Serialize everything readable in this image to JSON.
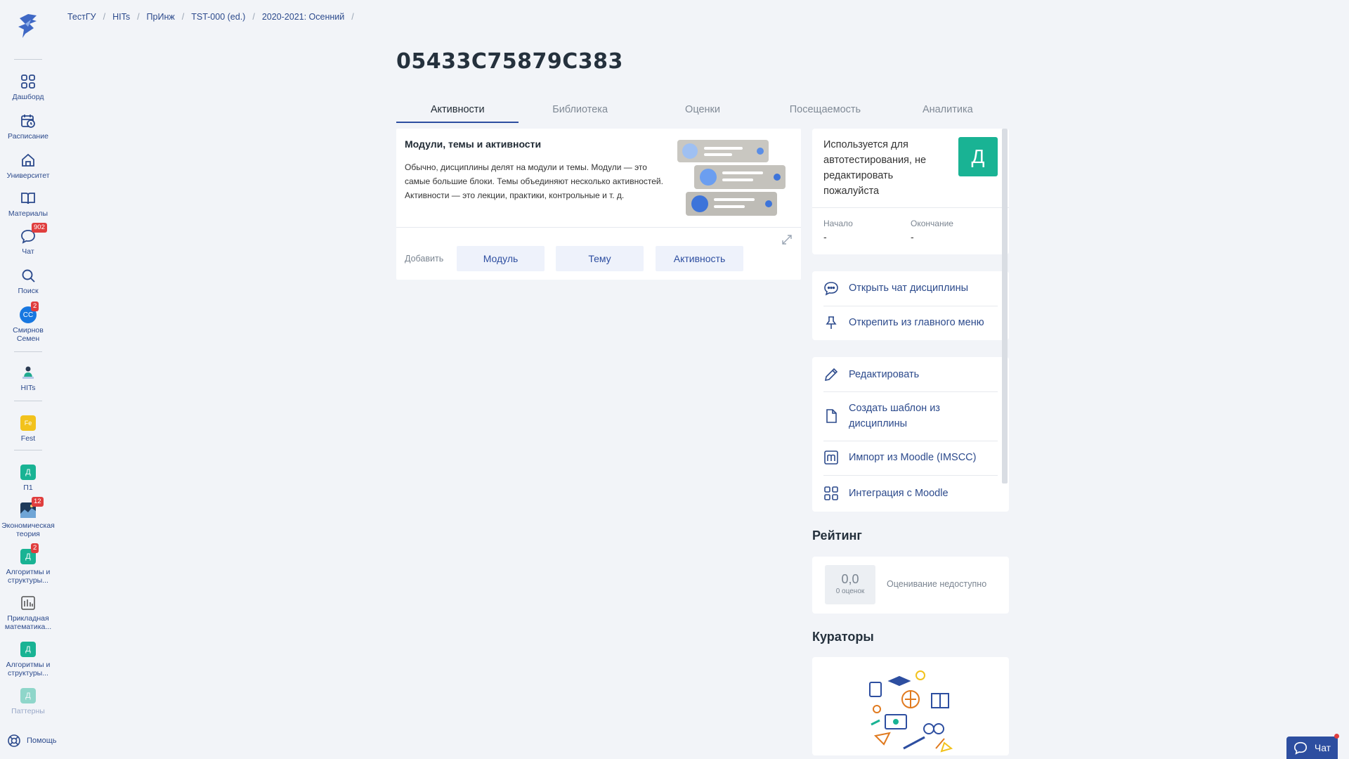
{
  "sidebar": {
    "items": [
      {
        "label": "Дашборд"
      },
      {
        "label": "Расписание"
      },
      {
        "label": "Университет"
      },
      {
        "label": "Материалы"
      },
      {
        "label": "Чат",
        "badge": "902"
      },
      {
        "label": "Поиск"
      },
      {
        "label": "Смирнов Семен",
        "avatar": "СС",
        "badge": "2"
      },
      {
        "label": "HITs"
      },
      {
        "label": "Fest",
        "avatar": "Fe"
      },
      {
        "label": "П1",
        "avatar": "Д"
      },
      {
        "label": "Экономическая теория",
        "badge": "12"
      },
      {
        "label": "Алгоритмы и структуры...",
        "avatar": "Д",
        "badge": "2"
      },
      {
        "label": "Прикладная математика..."
      },
      {
        "label": "Алгоритмы и структуры...",
        "avatar": "Д"
      },
      {
        "label": "Паттерны",
        "avatar": "Д"
      }
    ],
    "help_label": "Помощь"
  },
  "breadcrumbs": [
    "ТестГУ",
    "HITs",
    "ПрИнж",
    "TST-000 (ed.)",
    "2020-2021: Осенний"
  ],
  "page_title": "05433C75879C383",
  "tabs": [
    {
      "label": "Активности",
      "active": true
    },
    {
      "label": "Библиотека"
    },
    {
      "label": "Оценки"
    },
    {
      "label": "Посещаемость"
    },
    {
      "label": "Аналитика"
    }
  ],
  "modules_card": {
    "title": "Модули, темы и активности",
    "description": "Обычно, дисциплины делят на модули и темы. Модули — это самые большие блоки. Темы объединяют несколько активностей. Активности — это лекции, практики, контрольные и т. д.",
    "add_label": "Добавить",
    "buttons": [
      "Модуль",
      "Тему",
      "Активность"
    ]
  },
  "info_card": {
    "text": "Используется для автотестирования, не редактировать пожалуйста",
    "avatar_letter": "Д",
    "start_label": "Начало",
    "start_value": "-",
    "end_label": "Окончание",
    "end_value": "-"
  },
  "actions_group1": [
    {
      "label": "Открыть чат дисциплины",
      "icon": "chat-icon"
    },
    {
      "label": "Открепить из главного меню",
      "icon": "pin-icon"
    }
  ],
  "actions_group2": [
    {
      "label": "Редактировать",
      "icon": "pencil-icon"
    },
    {
      "label": "Создать шаблон из дисциплины",
      "icon": "file-icon"
    },
    {
      "label": "Импорт из Moodle (IMSCC)",
      "icon": "moodle-icon"
    },
    {
      "label": "Интеграция с Moodle",
      "icon": "grid-icon"
    }
  ],
  "rating": {
    "title": "Рейтинг",
    "score": "0,0",
    "count": "0 оценок",
    "note": "Оценивание недоступно"
  },
  "curators": {
    "title": "Кураторы"
  },
  "chat_button": {
    "label": "Чат"
  },
  "colors": {
    "accent": "#2d4ea0",
    "green": "#19b394",
    "badge": "#e03e3e"
  }
}
